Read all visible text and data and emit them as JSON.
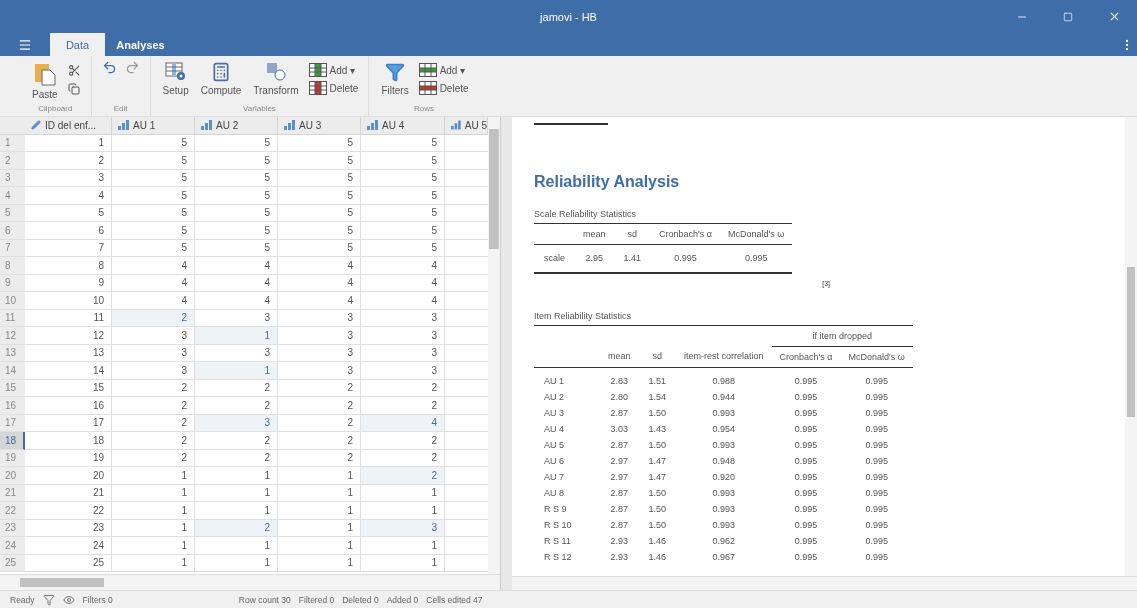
{
  "window": {
    "title": "jamovi - HB"
  },
  "tabs": [
    {
      "label": "Data",
      "selected": true
    },
    {
      "label": "Analyses",
      "selected": false
    }
  ],
  "toolbar": {
    "groups": [
      {
        "label": "Clipboard",
        "buttons": [
          {
            "kind": "paste",
            "label": "Paste"
          },
          {
            "kind": "cut"
          },
          {
            "kind": "copy"
          }
        ]
      },
      {
        "label": "Edit",
        "buttons": [
          {
            "kind": "undo"
          },
          {
            "kind": "redo"
          }
        ]
      },
      {
        "label": "Variables",
        "buttons": [
          {
            "kind": "setup",
            "label": "Setup"
          },
          {
            "kind": "compute",
            "label": "Compute"
          },
          {
            "kind": "transform",
            "label": "Transform"
          },
          {
            "kind": "col-add",
            "label": "Add",
            "caret": "▾"
          },
          {
            "kind": "col-delete",
            "label": "Delete"
          }
        ]
      },
      {
        "label": "Rows",
        "buttons": [
          {
            "kind": "filters",
            "label": "Filters"
          },
          {
            "kind": "row-add",
            "label": "Add",
            "caret": "▾"
          },
          {
            "kind": "row-delete",
            "label": "Delete"
          }
        ]
      }
    ]
  },
  "grid": {
    "columns": [
      {
        "label": "ID del enf...",
        "kind": "id"
      },
      {
        "label": "AU 1",
        "kind": "ordinal"
      },
      {
        "label": "AU 2",
        "kind": "ordinal"
      },
      {
        "label": "AU 3",
        "kind": "ordinal"
      },
      {
        "label": "AU 4",
        "kind": "ordinal"
      },
      {
        "label": "AU 5",
        "kind": "ordinal"
      }
    ],
    "rows": [
      {
        "n": "1",
        "selected": false,
        "cells": [
          {
            "v": "1",
            "edited": false
          },
          {
            "v": "5",
            "edited": false
          },
          {
            "v": "5",
            "edited": false
          },
          {
            "v": "5",
            "edited": false
          },
          {
            "v": "5",
            "edited": false
          }
        ]
      },
      {
        "n": "2",
        "selected": false,
        "cells": [
          {
            "v": "2",
            "edited": false
          },
          {
            "v": "5",
            "edited": false
          },
          {
            "v": "5",
            "edited": false
          },
          {
            "v": "5",
            "edited": false
          },
          {
            "v": "5",
            "edited": false
          }
        ]
      },
      {
        "n": "3",
        "selected": false,
        "cells": [
          {
            "v": "3",
            "edited": false
          },
          {
            "v": "5",
            "edited": false
          },
          {
            "v": "5",
            "edited": false
          },
          {
            "v": "5",
            "edited": false
          },
          {
            "v": "5",
            "edited": false
          }
        ]
      },
      {
        "n": "4",
        "selected": false,
        "cells": [
          {
            "v": "4",
            "edited": false
          },
          {
            "v": "5",
            "edited": false
          },
          {
            "v": "5",
            "edited": false
          },
          {
            "v": "5",
            "edited": false
          },
          {
            "v": "5",
            "edited": false
          }
        ]
      },
      {
        "n": "5",
        "selected": false,
        "cells": [
          {
            "v": "5",
            "edited": false
          },
          {
            "v": "5",
            "edited": false
          },
          {
            "v": "5",
            "edited": false
          },
          {
            "v": "5",
            "edited": false
          },
          {
            "v": "5",
            "edited": false
          }
        ]
      },
      {
        "n": "6",
        "selected": false,
        "cells": [
          {
            "v": "6",
            "edited": false
          },
          {
            "v": "5",
            "edited": false
          },
          {
            "v": "5",
            "edited": false
          },
          {
            "v": "5",
            "edited": false
          },
          {
            "v": "5",
            "edited": false
          }
        ]
      },
      {
        "n": "7",
        "selected": false,
        "cells": [
          {
            "v": "7",
            "edited": false
          },
          {
            "v": "5",
            "edited": false
          },
          {
            "v": "5",
            "edited": false
          },
          {
            "v": "5",
            "edited": false
          },
          {
            "v": "5",
            "edited": false
          }
        ]
      },
      {
        "n": "8",
        "selected": false,
        "cells": [
          {
            "v": "8",
            "edited": false
          },
          {
            "v": "4",
            "edited": false
          },
          {
            "v": "4",
            "edited": false
          },
          {
            "v": "4",
            "edited": false
          },
          {
            "v": "4",
            "edited": false
          }
        ]
      },
      {
        "n": "9",
        "selected": false,
        "cells": [
          {
            "v": "9",
            "edited": false
          },
          {
            "v": "4",
            "edited": false
          },
          {
            "v": "4",
            "edited": false
          },
          {
            "v": "4",
            "edited": false
          },
          {
            "v": "4",
            "edited": false
          }
        ]
      },
      {
        "n": "10",
        "selected": false,
        "cells": [
          {
            "v": "10",
            "edited": false
          },
          {
            "v": "4",
            "edited": false
          },
          {
            "v": "4",
            "edited": false
          },
          {
            "v": "4",
            "edited": false
          },
          {
            "v": "4",
            "edited": false
          }
        ]
      },
      {
        "n": "11",
        "selected": false,
        "cells": [
          {
            "v": "11",
            "edited": false
          },
          {
            "v": "2",
            "edited": true
          },
          {
            "v": "3",
            "edited": false
          },
          {
            "v": "3",
            "edited": false
          },
          {
            "v": "3",
            "edited": false
          }
        ]
      },
      {
        "n": "12",
        "selected": false,
        "cells": [
          {
            "v": "12",
            "edited": false
          },
          {
            "v": "3",
            "edited": false
          },
          {
            "v": "1",
            "edited": true
          },
          {
            "v": "3",
            "edited": false
          },
          {
            "v": "3",
            "edited": false
          }
        ]
      },
      {
        "n": "13",
        "selected": false,
        "cells": [
          {
            "v": "13",
            "edited": false
          },
          {
            "v": "3",
            "edited": false
          },
          {
            "v": "3",
            "edited": false
          },
          {
            "v": "3",
            "edited": false
          },
          {
            "v": "3",
            "edited": false
          }
        ]
      },
      {
        "n": "14",
        "selected": false,
        "cells": [
          {
            "v": "14",
            "edited": false
          },
          {
            "v": "3",
            "edited": false
          },
          {
            "v": "1",
            "edited": true
          },
          {
            "v": "3",
            "edited": false
          },
          {
            "v": "3",
            "edited": false
          }
        ]
      },
      {
        "n": "15",
        "selected": false,
        "cells": [
          {
            "v": "15",
            "edited": false
          },
          {
            "v": "2",
            "edited": false
          },
          {
            "v": "2",
            "edited": false
          },
          {
            "v": "2",
            "edited": false
          },
          {
            "v": "2",
            "edited": false
          }
        ]
      },
      {
        "n": "16",
        "selected": false,
        "cells": [
          {
            "v": "16",
            "edited": false
          },
          {
            "v": "2",
            "edited": false
          },
          {
            "v": "2",
            "edited": false
          },
          {
            "v": "2",
            "edited": false
          },
          {
            "v": "2",
            "edited": false
          }
        ]
      },
      {
        "n": "17",
        "selected": false,
        "cells": [
          {
            "v": "17",
            "edited": false
          },
          {
            "v": "2",
            "edited": false
          },
          {
            "v": "3",
            "edited": true
          },
          {
            "v": "2",
            "edited": false
          },
          {
            "v": "4",
            "edited": true
          }
        ]
      },
      {
        "n": "18",
        "selected": true,
        "cells": [
          {
            "v": "18",
            "edited": false
          },
          {
            "v": "2",
            "edited": false
          },
          {
            "v": "2",
            "edited": false
          },
          {
            "v": "2",
            "edited": false
          },
          {
            "v": "2",
            "edited": false
          }
        ]
      },
      {
        "n": "19",
        "selected": false,
        "cells": [
          {
            "v": "19",
            "edited": false
          },
          {
            "v": "2",
            "edited": false
          },
          {
            "v": "2",
            "edited": false
          },
          {
            "v": "2",
            "edited": false
          },
          {
            "v": "2",
            "edited": false
          }
        ]
      },
      {
        "n": "20",
        "selected": false,
        "cells": [
          {
            "v": "20",
            "edited": false
          },
          {
            "v": "1",
            "edited": false
          },
          {
            "v": "1",
            "edited": false
          },
          {
            "v": "1",
            "edited": false
          },
          {
            "v": "2",
            "edited": true
          }
        ]
      },
      {
        "n": "21",
        "selected": false,
        "cells": [
          {
            "v": "21",
            "edited": false
          },
          {
            "v": "1",
            "edited": false
          },
          {
            "v": "1",
            "edited": false
          },
          {
            "v": "1",
            "edited": false
          },
          {
            "v": "1",
            "edited": false
          }
        ]
      },
      {
        "n": "22",
        "selected": false,
        "cells": [
          {
            "v": "22",
            "edited": false
          },
          {
            "v": "1",
            "edited": false
          },
          {
            "v": "1",
            "edited": false
          },
          {
            "v": "1",
            "edited": false
          },
          {
            "v": "1",
            "edited": false
          }
        ]
      },
      {
        "n": "23",
        "selected": false,
        "cells": [
          {
            "v": "23",
            "edited": false
          },
          {
            "v": "1",
            "edited": false
          },
          {
            "v": "2",
            "edited": true
          },
          {
            "v": "1",
            "edited": false
          },
          {
            "v": "3",
            "edited": true
          }
        ]
      },
      {
        "n": "24",
        "selected": false,
        "cells": [
          {
            "v": "24",
            "edited": false
          },
          {
            "v": "1",
            "edited": false
          },
          {
            "v": "1",
            "edited": false
          },
          {
            "v": "1",
            "edited": false
          },
          {
            "v": "1",
            "edited": false
          }
        ]
      },
      {
        "n": "25",
        "selected": false,
        "cells": [
          {
            "v": "25",
            "edited": false
          },
          {
            "v": "1",
            "edited": false
          },
          {
            "v": "1",
            "edited": false
          },
          {
            "v": "1",
            "edited": false
          },
          {
            "v": "1",
            "edited": false
          }
        ]
      }
    ]
  },
  "status_bar": {
    "ready": "Ready",
    "filters": "Filters 0",
    "items": [
      "Row count 30",
      "Filtered 0",
      "Deleted 0",
      "Added 0",
      "Cells edited 47"
    ]
  },
  "results": {
    "title": "Reliability Analysis",
    "scale_table": {
      "caption": "Scale Reliability Statistics",
      "columns": [
        "",
        "mean",
        "sd",
        "Cronbach's α",
        "McDonald's ω"
      ],
      "rows": [
        [
          "scale",
          "2.95",
          "1.41",
          "0.995",
          "0.995"
        ]
      ],
      "note": "[3]"
    },
    "item_table": {
      "caption": "Item Reliability Statistics",
      "group_header": "if item dropped",
      "columns": [
        "",
        "mean",
        "sd",
        "item-rest correlation",
        "Cronbach's α",
        "McDonald's ω"
      ],
      "rows": [
        [
          "AU 1",
          "2.83",
          "1.51",
          "0.988",
          "0.995",
          "0.995"
        ],
        [
          "AU 2",
          "2.80",
          "1.54",
          "0.944",
          "0.995",
          "0.995"
        ],
        [
          "AU 3",
          "2.87",
          "1.50",
          "0.993",
          "0.995",
          "0.995"
        ],
        [
          "AU 4",
          "3.03",
          "1.43",
          "0.954",
          "0.995",
          "0.995"
        ],
        [
          "AU 5",
          "2.87",
          "1.50",
          "0.993",
          "0.995",
          "0.995"
        ],
        [
          "AU 6",
          "2.97",
          "1.47",
          "0.948",
          "0.995",
          "0.995"
        ],
        [
          "AU 7",
          "2.97",
          "1.47",
          "0.920",
          "0.995",
          "0.995"
        ],
        [
          "AU 8",
          "2.87",
          "1.50",
          "0.993",
          "0.995",
          "0.995"
        ],
        [
          "R S 9",
          "2.87",
          "1.50",
          "0.993",
          "0.995",
          "0.995"
        ],
        [
          "R S 10",
          "2.87",
          "1.50",
          "0.993",
          "0.995",
          "0.995"
        ],
        [
          "R S 11",
          "2.93",
          "1.46",
          "0.962",
          "0.995",
          "0.995"
        ],
        [
          "R S 12",
          "2.93",
          "1.46",
          "0.967",
          "0.995",
          "0.995"
        ]
      ]
    }
  }
}
